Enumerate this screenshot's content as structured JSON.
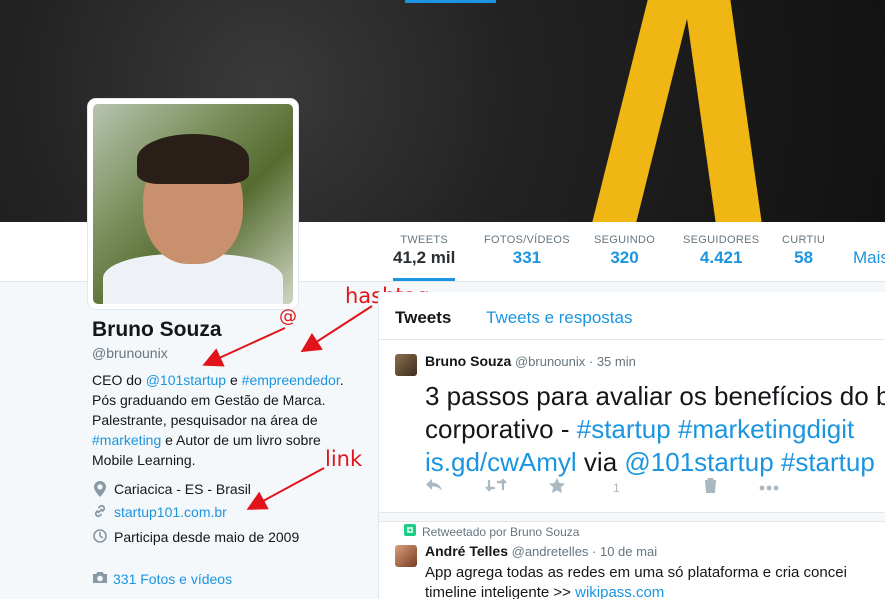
{
  "stats": [
    {
      "label": "TWEETS",
      "value": "41,2 mil"
    },
    {
      "label": "FOTOS/VÍDEOS",
      "value": "331"
    },
    {
      "label": "SEGUINDO",
      "value": "320"
    },
    {
      "label": "SEGUIDORES",
      "value": "4.421"
    },
    {
      "label": "CURTIU",
      "value": "58"
    }
  ],
  "stats_more": "Mais",
  "profile": {
    "name": "Bruno Souza",
    "handle": "@brunounix",
    "bio": {
      "p1": "CEO do ",
      "mention": "@101startup",
      "p2": " e ",
      "hashtag1": "#empreendedor",
      "p3": ". Pós graduando em Gestão de Marca. Palestrante, pesquisador na área de ",
      "hashtag2": "#marketing",
      "p4": " e Autor de um livro sobre Mobile Learning."
    },
    "location": "Cariacica - ES - Brasil",
    "website": "startup101.com.br",
    "joined": "Participa desde maio de 2009",
    "photos": "331 Fotos e vídeos"
  },
  "annotations": {
    "at": "@",
    "hashtag": "hashtag",
    "link": "link"
  },
  "timeline": {
    "tabs": [
      "Tweets",
      "Tweets e respostas"
    ],
    "tweet1": {
      "author": "Bruno Souza",
      "handle": "@brunounix",
      "time": "· 35 min",
      "line1": "3 passos para avaliar os benefícios do b",
      "line2_a": "corporativo - ",
      "line2_b": "#startup #marketingdigit",
      "line3_a": "is.gd/cwAmyl",
      "line3_b": " via ",
      "line3_c": "@101startup #startup",
      "like_count": "1"
    },
    "tweet2": {
      "retweeted_by": "Retweetado por Bruno Souza",
      "author": "André Telles",
      "handle": "@andretelles",
      "time": "· 10 de mai",
      "line1": "App agrega todas as redes em uma só plataforma e cria concei",
      "line2_a": "timeline inteligente >> ",
      "line2_b": "wikipass.com"
    }
  },
  "colors": {
    "accent": "#1b95e0",
    "annotation": "#e0141a",
    "retweet": "#19cf86"
  }
}
